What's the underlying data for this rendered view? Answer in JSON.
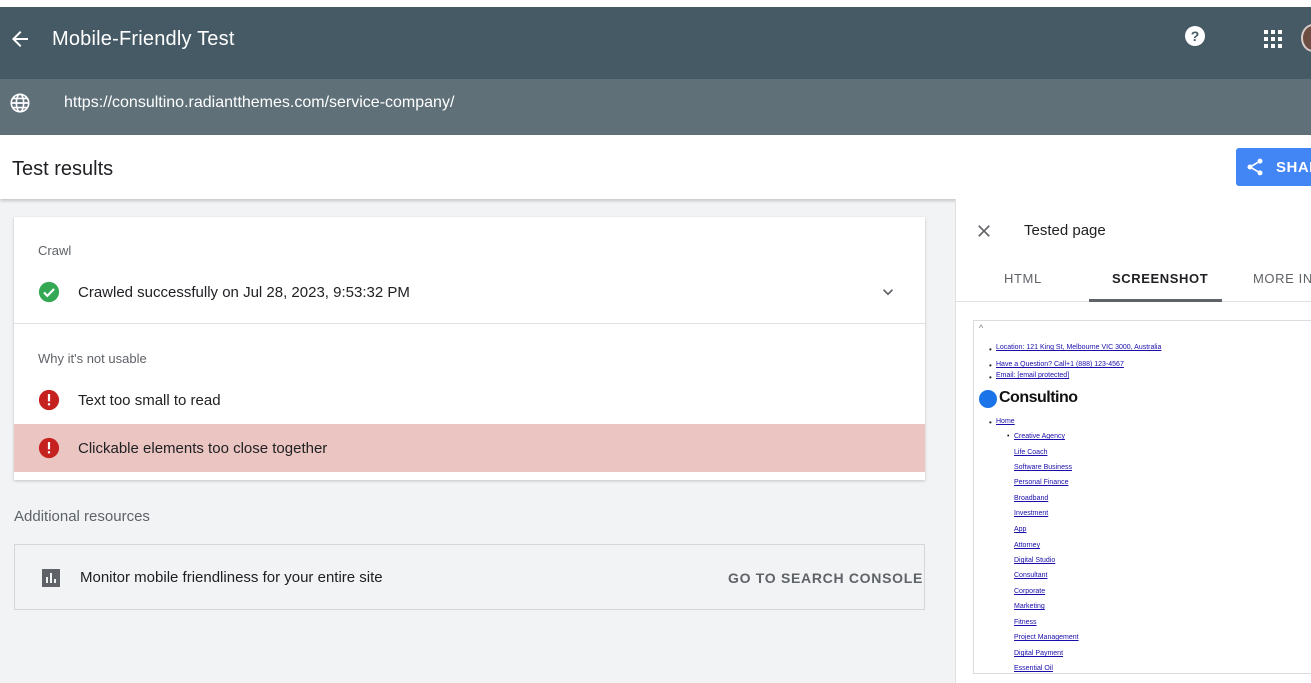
{
  "app": {
    "title": "Mobile-Friendly Test",
    "tested_url": "https://consultino.radiantthemes.com/service-company/"
  },
  "results": {
    "heading": "Test results",
    "share_label": "SHARE"
  },
  "crawl": {
    "section_label": "Crawl",
    "status_text": "Crawled successfully on Jul 28, 2023, 9:53:32 PM"
  },
  "issues": {
    "section_label": "Why it's not usable",
    "items": [
      {
        "label": "Text too small to read"
      },
      {
        "label": "Clickable elements too close together"
      }
    ]
  },
  "additional": {
    "heading": "Additional resources",
    "monitor_text": "Monitor mobile friendliness for your entire site",
    "console_link": "GO TO SEARCH CONSOLE"
  },
  "panel": {
    "title": "Tested page",
    "tabs": [
      {
        "label": "HTML"
      },
      {
        "label": "SCREENSHOT"
      },
      {
        "label": "MORE INFO"
      }
    ],
    "active_tab": "SCREENSHOT",
    "screenshot": {
      "top_links": [
        "Location: 121 King St, Melbourne VIC 3000, Australia",
        "Have a Question? Call+1 (888) 123-4567",
        "Email: [email protected]"
      ],
      "logo_text": "Consultino",
      "home_link": "Home",
      "menu_links": [
        "Creative Agency",
        "Life Coach",
        "Software Business",
        "Personal Finance",
        "Broadband",
        "Investment",
        "App",
        "Attorney",
        "Digital Studio",
        "Consultant",
        "Corporate",
        "Marketing",
        "Fitness",
        "Project Management",
        "Digital Payment",
        "Essential Oil"
      ]
    }
  },
  "colors": {
    "appbar": "#455a64",
    "urlbar": "#5f7079",
    "accent": "#4285f4",
    "success": "#34a853",
    "error": "#c5221f",
    "error_highlight": "#ebc5c1"
  },
  "icons": [
    "arrow-back-icon",
    "help-icon",
    "apps-icon",
    "globe-icon",
    "share-icon",
    "check-circle-icon",
    "chevron-down-icon",
    "error-icon",
    "bar-chart-icon",
    "close-icon"
  ]
}
